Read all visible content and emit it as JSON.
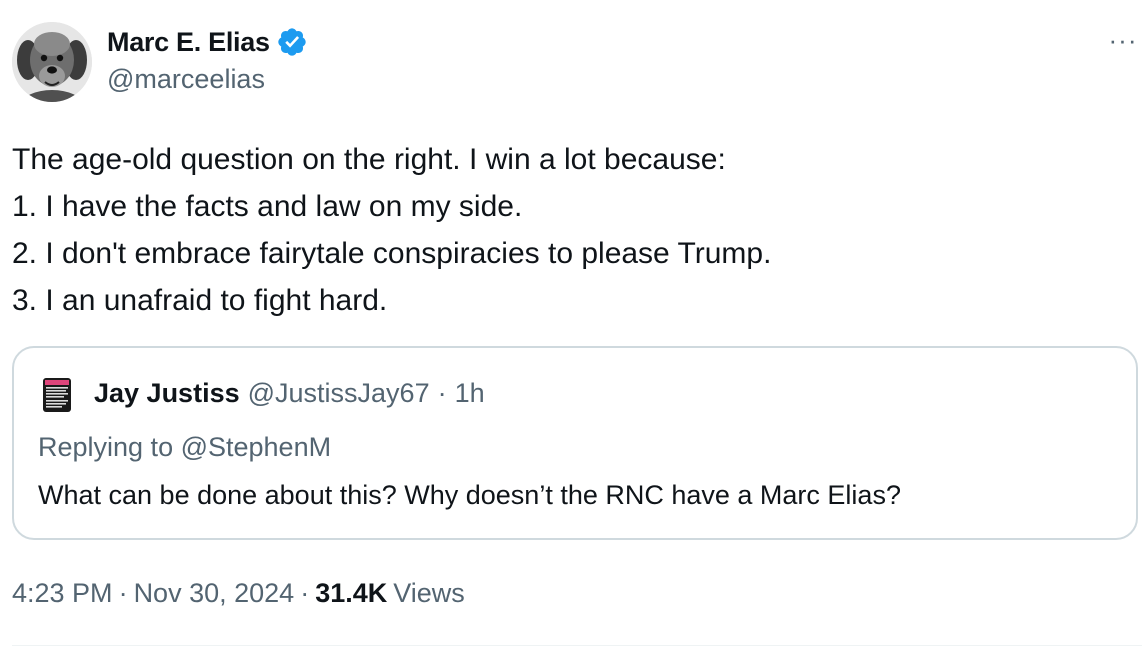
{
  "author": {
    "display_name": "Marc E. Elias",
    "handle": "@marceelias",
    "verified_icon": "verified-badge-icon",
    "avatar_icon": "dog-avatar"
  },
  "menu": {
    "more_label": "···"
  },
  "tweet": {
    "lines": [
      "The age-old question on the right. I win a lot because:",
      "1. I have the facts and law on my side.",
      "2. I don't embrace fairytale conspiracies to please Trump.",
      "3. I an unafraid to fight hard."
    ]
  },
  "quoted_tweet": {
    "display_name": "Jay Justiss",
    "handle": "@JustissJay67",
    "separator": "·",
    "time": "1h",
    "replying_to": "Replying to @StephenM",
    "text": "What can be done about this? Why doesn’t the RNC have a Marc Elias?"
  },
  "meta": {
    "time": "4:23 PM",
    "separator": "·",
    "date": "Nov 30, 2024",
    "views_count": "31.4K",
    "views_label": "Views"
  },
  "colors": {
    "text": "#0f1419",
    "secondary": "#536471",
    "verified_blue": "#1d9bf0",
    "border": "#cfd9de"
  }
}
